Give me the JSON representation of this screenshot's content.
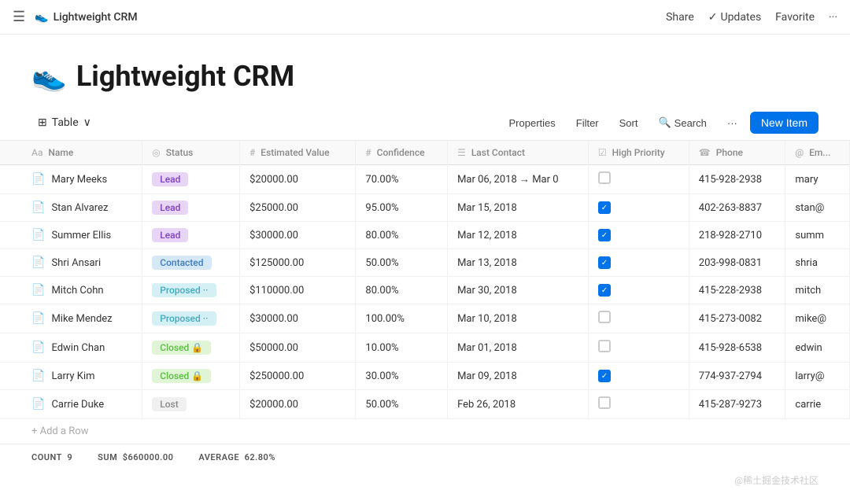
{
  "topbar": {
    "hamburger": "☰",
    "icon": "👟",
    "title": "Lightweight CRM",
    "share_label": "Share",
    "updates_check": "✓",
    "updates_label": "Updates",
    "favorite_label": "Favorite",
    "more_label": "···"
  },
  "page_header": {
    "icon": "👟",
    "title": "Lightweight CRM"
  },
  "toolbar": {
    "table_icon": "⊞",
    "view_label": "Table",
    "chevron": "∨",
    "properties_label": "Properties",
    "filter_label": "Filter",
    "sort_label": "Sort",
    "search_icon": "🔍",
    "search_label": "Search",
    "more_label": "···",
    "new_item_label": "New Item"
  },
  "table": {
    "columns": [
      {
        "icon": "Aa",
        "label": "Name"
      },
      {
        "icon": "◎",
        "label": "Status"
      },
      {
        "icon": "#",
        "label": "Estimated Value"
      },
      {
        "icon": "#",
        "label": "Confidence"
      },
      {
        "icon": "☰",
        "label": "Last Contact"
      },
      {
        "icon": "☑",
        "label": "High Priority"
      },
      {
        "icon": "☎",
        "label": "Phone"
      },
      {
        "icon": "@",
        "label": "Em..."
      }
    ],
    "rows": [
      {
        "name": "Mary Meeks",
        "status": "Lead",
        "status_type": "lead",
        "estimated_value": "$20000.00",
        "confidence": "70.00%",
        "last_contact": "Mar 06, 2018 → Mar 0",
        "high_priority": false,
        "phone": "415-928-2938",
        "email_prefix": "mary"
      },
      {
        "name": "Stan Alvarez",
        "status": "Lead",
        "status_type": "lead",
        "estimated_value": "$25000.00",
        "confidence": "95.00%",
        "last_contact": "Mar 15, 2018",
        "high_priority": true,
        "phone": "402-263-8837",
        "email_prefix": "stan@"
      },
      {
        "name": "Summer Ellis",
        "status": "Lead",
        "status_type": "lead",
        "estimated_value": "$30000.00",
        "confidence": "80.00%",
        "last_contact": "Mar 12, 2018",
        "high_priority": true,
        "phone": "218-928-2710",
        "email_prefix": "summ"
      },
      {
        "name": "Shri Ansari",
        "status": "Contacted",
        "status_type": "contacted",
        "estimated_value": "$125000.00",
        "confidence": "50.00%",
        "last_contact": "Mar 13, 2018",
        "high_priority": true,
        "phone": "203-998-0831",
        "email_prefix": "shria"
      },
      {
        "name": "Mitch Cohn",
        "status": "Proposed ··",
        "status_type": "proposed",
        "estimated_value": "$110000.00",
        "confidence": "80.00%",
        "last_contact": "Mar 30, 2018",
        "high_priority": true,
        "phone": "415-228-2938",
        "email_prefix": "mitch"
      },
      {
        "name": "Mike Mendez",
        "status": "Proposed ··",
        "status_type": "proposed",
        "estimated_value": "$30000.00",
        "confidence": "100.00%",
        "last_contact": "Mar 10, 2018",
        "high_priority": false,
        "phone": "415-273-0082",
        "email_prefix": "mike@"
      },
      {
        "name": "Edwin Chan",
        "status": "Closed 🔒",
        "status_type": "closed",
        "estimated_value": "$50000.00",
        "confidence": "10.00%",
        "last_contact": "Mar 01, 2018",
        "high_priority": false,
        "phone": "415-928-6538",
        "email_prefix": "edwin"
      },
      {
        "name": "Larry Kim",
        "status": "Closed 🔒",
        "status_type": "closed",
        "estimated_value": "$250000.00",
        "confidence": "30.00%",
        "last_contact": "Mar 09, 2018",
        "high_priority": true,
        "phone": "774-937-2794",
        "email_prefix": "larry@"
      },
      {
        "name": "Carrie Duke",
        "status": "Lost",
        "status_type": "lost",
        "estimated_value": "$20000.00",
        "confidence": "50.00%",
        "last_contact": "Feb 26, 2018",
        "high_priority": false,
        "phone": "415-287-9273",
        "email_prefix": "carrie"
      }
    ]
  },
  "footer": {
    "count_label": "COUNT",
    "count_value": "9",
    "sum_label": "SUM",
    "sum_value": "$660000.00",
    "avg_label": "AVERAGE",
    "avg_value": "62.80%"
  },
  "add_row_label": "+ Add a Row",
  "watermark": "@稀土掘金技术社区"
}
